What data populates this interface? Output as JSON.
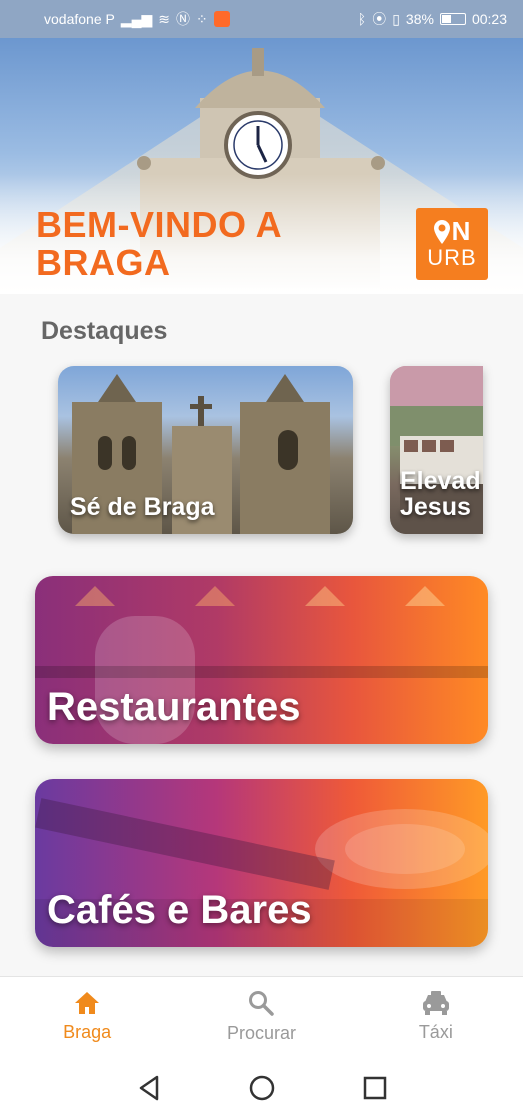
{
  "status_bar": {
    "carrier": "vodafone P",
    "battery_percent": "38%",
    "time": "00:23"
  },
  "hero": {
    "title_line1": "BEM-VINDO A",
    "title_line2": "BRAGA",
    "logo_top": "N",
    "logo_bottom": "URB"
  },
  "highlights": {
    "title": "Destaques",
    "items": [
      {
        "label": "Sé de Braga"
      },
      {
        "label_line1": "Elevad",
        "label_line2": "Jesus"
      }
    ]
  },
  "categories": [
    {
      "label": "Restaurantes"
    },
    {
      "label": "Cafés e Bares"
    }
  ],
  "bottom_nav": {
    "items": [
      {
        "label": "Braga",
        "icon": "home-icon",
        "active": true
      },
      {
        "label": "Procurar",
        "icon": "search-icon",
        "active": false
      },
      {
        "label": "Táxi",
        "icon": "taxi-icon",
        "active": false
      }
    ]
  },
  "colors": {
    "accent": "#f26a1f",
    "nav_active": "#f08a1c",
    "nav_inactive": "#9a9a9a"
  }
}
